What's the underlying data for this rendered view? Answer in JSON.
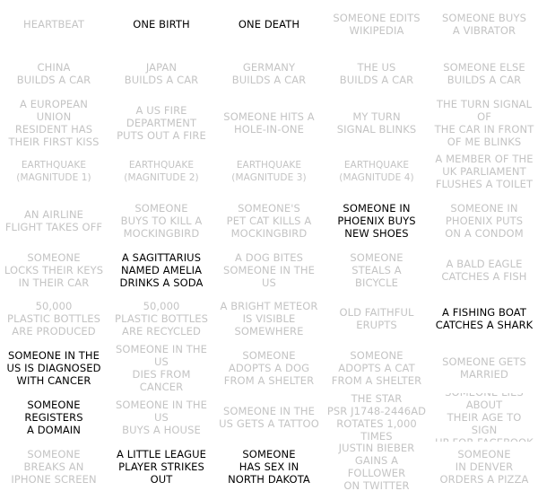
{
  "colors": {
    "active": "#000000",
    "inactive": "#c4c4c4",
    "background": "#ffffff"
  },
  "grid": {
    "columns": 5,
    "rows": 10,
    "cells": [
      {
        "text": "HEARTBEAT",
        "active": false
      },
      {
        "text": "ONE BIRTH",
        "active": true
      },
      {
        "text": "ONE DEATH",
        "active": true
      },
      {
        "text": "SOMEONE EDITS\nWIKIPEDIA",
        "active": false
      },
      {
        "text": "SOMEONE BUYS\nA VIBRATOR",
        "active": false
      },
      {
        "text": "CHINA\nBUILDS A CAR",
        "active": false
      },
      {
        "text": "JAPAN\nBUILDS A CAR",
        "active": false
      },
      {
        "text": "GERMANY\nBUILDS A CAR",
        "active": false
      },
      {
        "text": "THE US\nBUILDS A CAR",
        "active": false
      },
      {
        "text": "SOMEONE ELSE\nBUILDS A CAR",
        "active": false
      },
      {
        "text": "A EUROPEAN UNION\nRESIDENT HAS\nTHEIR FIRST KISS",
        "active": false
      },
      {
        "text": "A US FIRE\nDEPARTMENT\nPUTS OUT A FIRE",
        "active": false
      },
      {
        "text": "SOMEONE HITS A\nHOLE-IN-ONE",
        "active": false
      },
      {
        "text": "MY TURN\nSIGNAL BLINKS",
        "active": false
      },
      {
        "text": "THE TURN SIGNAL OF\nTHE CAR IN FRONT\nOF ME BLINKS",
        "active": false
      },
      {
        "text": "EARTHQUAKE\n(MAGNITUDE 1)",
        "active": false
      },
      {
        "text": "EARTHQUAKE\n(MAGNITUDE 2)",
        "active": false
      },
      {
        "text": "EARTHQUAKE\n(MAGNITUDE 3)",
        "active": false
      },
      {
        "text": "EARTHQUAKE\n(MAGNITUDE 4)",
        "active": false
      },
      {
        "text": "A MEMBER OF THE\nUK PARLIAMENT\nFLUSHES A TOILET",
        "active": false
      },
      {
        "text": "AN AIRLINE\nFLIGHT TAKES OFF",
        "active": false
      },
      {
        "text": "SOMEONE\nBUYS TO KILL A\nMOCKINGBIRD",
        "active": false
      },
      {
        "text": "SOMEONE'S\nPET CAT KILLS A\nMOCKINGBIRD",
        "active": false
      },
      {
        "text": "SOMEONE IN\nPHOENIX BUYS\nNEW SHOES",
        "active": true
      },
      {
        "text": "SOMEONE IN\nPHOENIX PUTS\nON A CONDOM",
        "active": false
      },
      {
        "text": "SOMEONE\nLOCKS THEIR KEYS\nIN THEIR CAR",
        "active": false
      },
      {
        "text": "A SAGITTARIUS\nNAMED AMELIA\nDRINKS A SODA",
        "active": true
      },
      {
        "text": "A DOG BITES\nSOMEONE IN THE US",
        "active": false
      },
      {
        "text": "SOMEONE\nSTEALS A\nBICYCLE",
        "active": false
      },
      {
        "text": "A BALD EAGLE\nCATCHES A FISH",
        "active": false
      },
      {
        "text": "50,000\nPLASTIC BOTTLES\nARE PRODUCED",
        "active": false
      },
      {
        "text": "50,000\nPLASTIC BOTTLES\nARE RECYCLED",
        "active": false
      },
      {
        "text": "A BRIGHT METEOR\nIS VISIBLE\nSOMEWHERE",
        "active": false
      },
      {
        "text": "OLD FAITHFUL\nERUPTS",
        "active": false
      },
      {
        "text": "A FISHING BOAT\nCATCHES A SHARK",
        "active": true
      },
      {
        "text": "SOMEONE IN THE\nUS IS DIAGNOSED\nWITH CANCER",
        "active": true
      },
      {
        "text": "SOMEONE IN THE US\nDIES FROM CANCER",
        "active": false
      },
      {
        "text": "SOMEONE\nADOPTS A DOG\nFROM A SHELTER",
        "active": false
      },
      {
        "text": "SOMEONE\nADOPTS A CAT\nFROM A SHELTER",
        "active": false
      },
      {
        "text": "SOMEONE GETS\nMARRIED",
        "active": false
      },
      {
        "text": "SOMEONE\nREGISTERS\nA DOMAIN",
        "active": true
      },
      {
        "text": "SOMEONE IN THE US\nBUYS A HOUSE",
        "active": false
      },
      {
        "text": "SOMEONE IN THE\nUS GETS A TATTOO",
        "active": false
      },
      {
        "text": "THE STAR\nPSR J1748-2446AD\nROTATES 1,000 TIMES",
        "active": false
      },
      {
        "text": "SOMEONE LIES ABOUT\nTHEIR AGE TO SIGN\nUP FOR FACEBOOK",
        "active": false
      },
      {
        "text": "SOMEONE\nBREAKS AN\nIPHONE SCREEN",
        "active": false
      },
      {
        "text": "A LITTLE LEAGUE\nPLAYER STRIKES OUT",
        "active": true
      },
      {
        "text": "SOMEONE\nHAS SEX IN\nNORTH DAKOTA",
        "active": true
      },
      {
        "text": "JUSTIN BIEBER\nGAINS A FOLLOWER\nON TWITTER",
        "active": false
      },
      {
        "text": "SOMEONE\nIN DENVER\nORDERS A PIZZA",
        "active": false
      }
    ]
  }
}
